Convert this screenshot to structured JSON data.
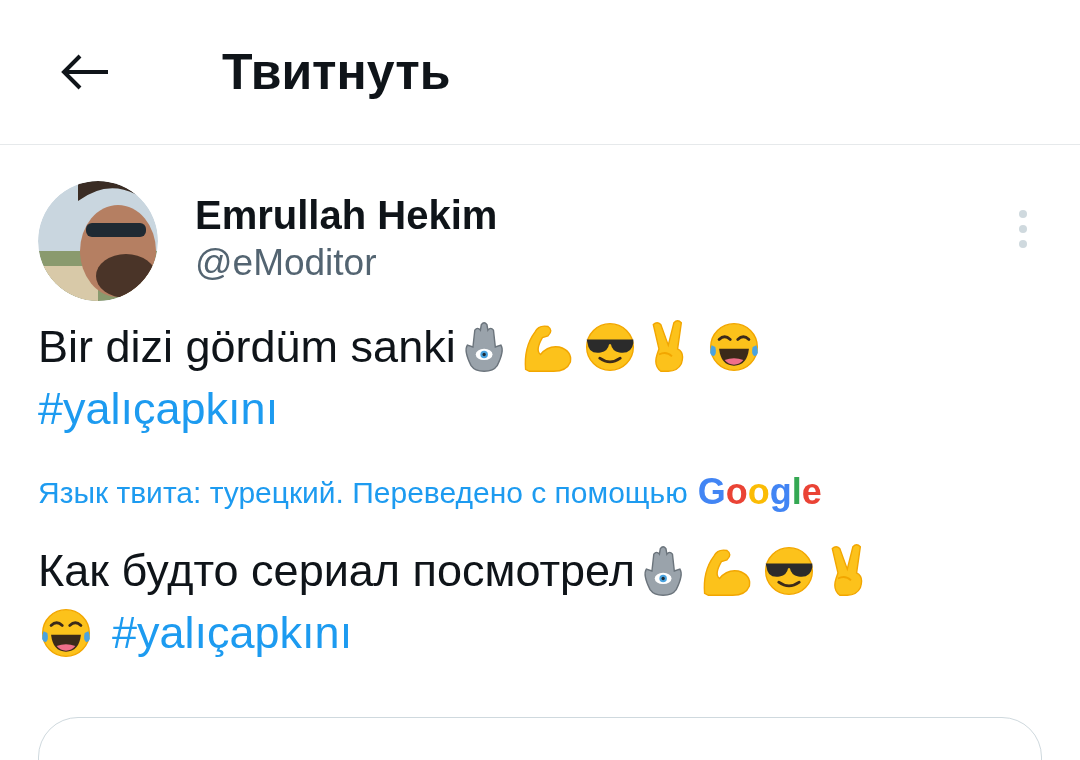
{
  "header": {
    "title": "Твитнуть"
  },
  "tweet": {
    "author": "Emrullah Hekim",
    "handle": "@eModitor",
    "text": "Bir dizi gördüm sanki",
    "hashtag": "#yalıçapkını"
  },
  "translation": {
    "label": "Язык твита: турецкий. Переведено с помощью",
    "provider": "Google",
    "text": "Как будто сериал посмотрел",
    "hashtag": "#yalıçapkını"
  }
}
